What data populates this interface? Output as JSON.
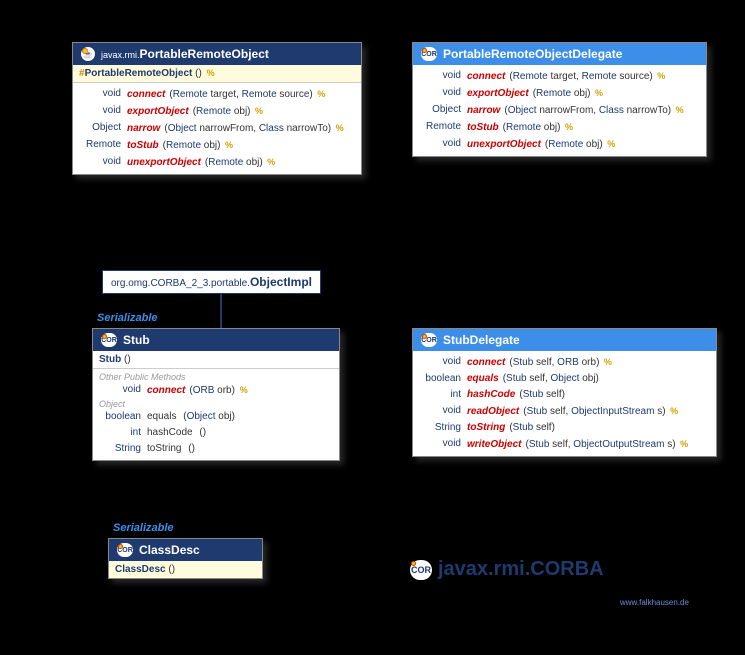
{
  "portableRemoteObject": {
    "pkg": "javax.rmi.",
    "name": "PortableRemoteObject",
    "ctor": "PortableRemoteObject",
    "ctorParams": "()",
    "throws": "%",
    "methods": [
      {
        "ret": "void",
        "name": "connect",
        "params": [
          [
            "Remote",
            "target"
          ],
          [
            "Remote",
            "source"
          ]
        ],
        "throws": true
      },
      {
        "ret": "void",
        "name": "exportObject",
        "params": [
          [
            "Remote",
            "obj"
          ]
        ],
        "throws": true
      },
      {
        "ret": "Object",
        "name": "narrow",
        "params": [
          [
            "Object",
            "narrowFrom"
          ],
          [
            "Class",
            "narrowTo"
          ]
        ],
        "throws": true
      },
      {
        "ret": "Remote",
        "name": "toStub",
        "params": [
          [
            "Remote",
            "obj"
          ]
        ],
        "throws": true
      },
      {
        "ret": "void",
        "name": "unexportObject",
        "params": [
          [
            "Remote",
            "obj"
          ]
        ],
        "throws": true
      }
    ]
  },
  "portableRemoteObjectDelegate": {
    "name": "PortableRemoteObjectDelegate",
    "methods": [
      {
        "ret": "void",
        "name": "connect",
        "params": [
          [
            "Remote",
            "target"
          ],
          [
            "Remote",
            "source"
          ]
        ],
        "throws": true
      },
      {
        "ret": "void",
        "name": "exportObject",
        "params": [
          [
            "Remote",
            "obj"
          ]
        ],
        "throws": true
      },
      {
        "ret": "Object",
        "name": "narrow",
        "params": [
          [
            "Object",
            "narrowFrom"
          ],
          [
            "Class",
            "narrowTo"
          ]
        ],
        "throws": true
      },
      {
        "ret": "Remote",
        "name": "toStub",
        "params": [
          [
            "Remote",
            "obj"
          ]
        ],
        "throws": true
      },
      {
        "ret": "void",
        "name": "unexportObject",
        "params": [
          [
            "Remote",
            "obj"
          ]
        ],
        "throws": true
      }
    ]
  },
  "objectImpl": {
    "pkg": "org.omg.CORBA_2_3.portable.",
    "name": "ObjectImpl"
  },
  "serializable1": "Serializable",
  "serializable2": "Serializable",
  "stub": {
    "name": "Stub",
    "ctor": "Stub",
    "ctorParams": "()",
    "otherLabel": "Other Public Methods",
    "connect": {
      "ret": "void",
      "name": "connect",
      "params": [
        [
          "ORB",
          "orb"
        ]
      ],
      "throws": true
    },
    "objectLabel": "Object",
    "equals": {
      "ret": "boolean",
      "name": "equals",
      "params": [
        [
          "Object",
          "obj"
        ]
      ]
    },
    "hashCode": {
      "ret": "int",
      "name": "hashCode",
      "params": []
    },
    "toString": {
      "ret": "String",
      "name": "toString",
      "params": []
    }
  },
  "stubDelegate": {
    "name": "StubDelegate",
    "methods": [
      {
        "ret": "void",
        "name": "connect",
        "params": [
          [
            "Stub",
            "self"
          ],
          [
            "ORB",
            "orb"
          ]
        ],
        "throws": true
      },
      {
        "ret": "boolean",
        "name": "equals",
        "params": [
          [
            "Stub",
            "self"
          ],
          [
            "Object",
            "obj"
          ]
        ]
      },
      {
        "ret": "int",
        "name": "hashCode",
        "params": [
          [
            "Stub",
            "self"
          ]
        ]
      },
      {
        "ret": "void",
        "name": "readObject",
        "params": [
          [
            "Stub",
            "self"
          ],
          [
            "ObjectInputStream",
            "s"
          ]
        ],
        "throws": true
      },
      {
        "ret": "String",
        "name": "toString",
        "params": [
          [
            "Stub",
            "self"
          ]
        ]
      },
      {
        "ret": "void",
        "name": "writeObject",
        "params": [
          [
            "Stub",
            "self"
          ],
          [
            "ObjectOutputStream",
            "s"
          ]
        ],
        "throws": true
      }
    ]
  },
  "classDesc": {
    "name": "ClassDesc",
    "ctor": "ClassDesc",
    "ctorParams": "()"
  },
  "packageTitle": "javax.rmi.CORBA",
  "watermark": "www.falkhausen.de"
}
